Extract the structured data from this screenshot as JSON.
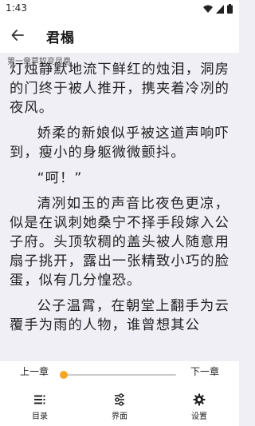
{
  "status_bar": {
    "time": "1:43",
    "icons": [
      "wifi-icon",
      "cell-signal-icon",
      "battery-icon"
    ]
  },
  "app_bar": {
    "title": "君榻",
    "back_icon": "arrow-left-icon"
  },
  "chapter": {
    "title": "第一章草奴变凤凰"
  },
  "content": {
    "paragraphs": [
      "灯烛静默地流下鲜红的烛泪，洞房的门终于被人推开，携夹着冷冽的夜风。",
      "娇柔的新娘似乎被这道声响吓到，瘦小的身躯微微颤抖。",
      "“呵！”",
      "清冽如玉的声音比夜色更凉，似是在讽刺她桑宁不择手段嫁入公子府。头顶软稠的盖头被人随意用扇子挑开，露出一张精致小巧的脸蛋，似有几分惶恐。",
      "公子温霄，在朝堂上翻手为云覆手为雨的人物，谁曾想其公"
    ]
  },
  "controls": {
    "prev_label": "上一章",
    "next_label": "下一章",
    "progress": 0.0
  },
  "bottom_nav": [
    {
      "label": "目录",
      "icon": "list-icon"
    },
    {
      "label": "界面",
      "icon": "sliders-icon"
    },
    {
      "label": "设置",
      "icon": "gear-icon"
    }
  ],
  "colors": {
    "accent": "#f5a623",
    "page_background": "#f0eff6",
    "bar_background": "#ffffff",
    "text": "#222222"
  }
}
